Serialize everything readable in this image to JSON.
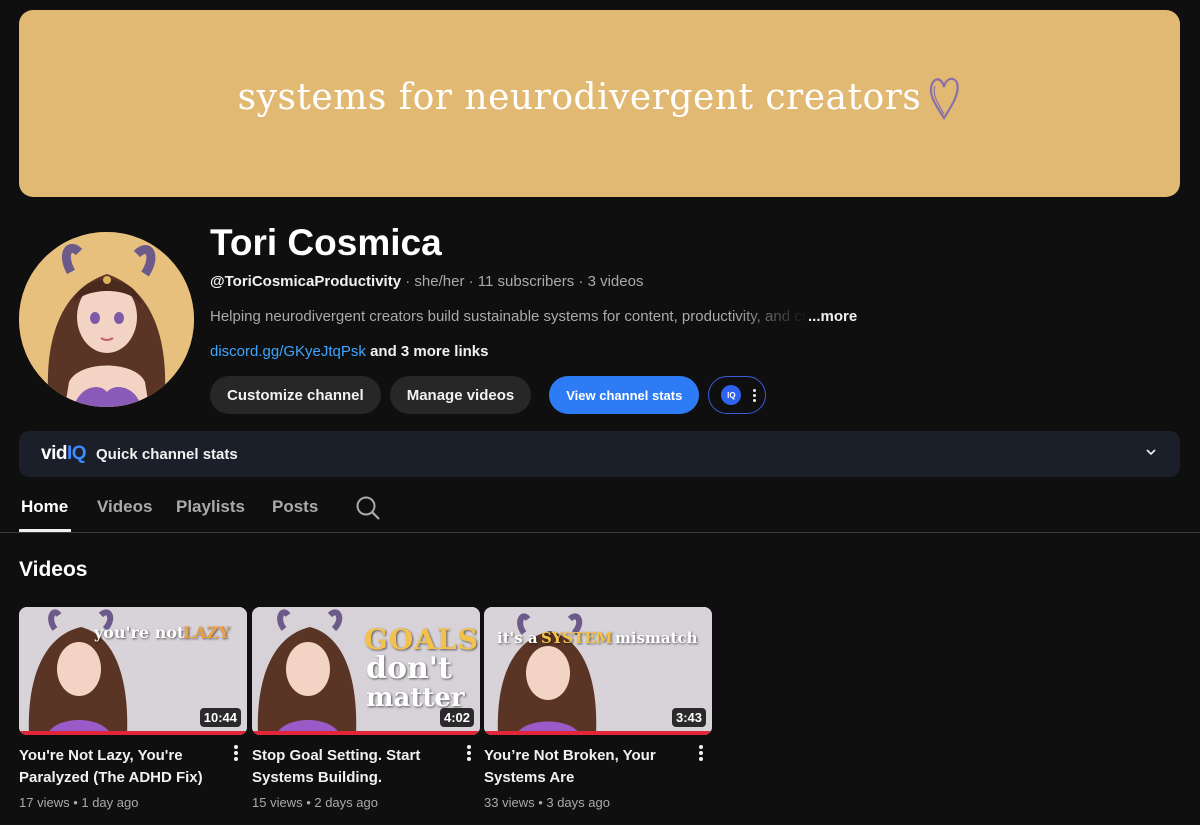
{
  "banner": {
    "text": "systems for neurodivergent creators"
  },
  "channel": {
    "name": "Tori Cosmica",
    "handle": "@ToriCosmicaProductivity",
    "pronouns": "she/her",
    "subscribers": "11 subscribers",
    "videos_count": "3 videos",
    "separator": " · ",
    "description": "Helping neurodivergent creators build sustainable systems for content, productivity, and creativity",
    "more_label": "...more",
    "link": "discord.gg/GKyeJtqPsk",
    "more_links": "and 3 more links"
  },
  "buttons": {
    "customize": "Customize channel",
    "manage": "Manage videos",
    "view_stats": "View channel stats",
    "vidiq_badge": "IQ"
  },
  "vidiq": {
    "logo_vid": "vid",
    "logo_iq": "IQ",
    "title": "Quick channel stats"
  },
  "tabs": [
    {
      "label": "Home",
      "active": true
    },
    {
      "label": "Videos"
    },
    {
      "label": "Playlists"
    },
    {
      "label": "Posts"
    }
  ],
  "section": {
    "title": "Videos"
  },
  "videos": [
    {
      "title": "You're Not Lazy, You're Paralyzed (The ADHD Fix)",
      "duration": "10:44",
      "views": "17 views",
      "age": "1 day ago",
      "thumb_text_a": "you're not",
      "thumb_text_b": "LAZY"
    },
    {
      "title": "Stop Goal Setting. Start Systems Building.",
      "duration": "4:02",
      "views": "15 views",
      "age": "2 days ago",
      "thumb_text_a": "GOALS",
      "thumb_text_b": "don't",
      "thumb_text_c": "matter"
    },
    {
      "title": "You’re Not Broken, Your Systems Are",
      "duration": "3:43",
      "views": "33 views",
      "age": "3 days ago",
      "thumb_text_a": "it's a",
      "thumb_text_b": "SYSTEM",
      "thumb_text_c": "mismatch"
    }
  ],
  "colors": {
    "banner": "#e1b973",
    "accent_blue": "#2e7bf6",
    "link_blue": "#3ea6ff",
    "progress_red": "#e3253a",
    "background": "#0f0f0f"
  }
}
